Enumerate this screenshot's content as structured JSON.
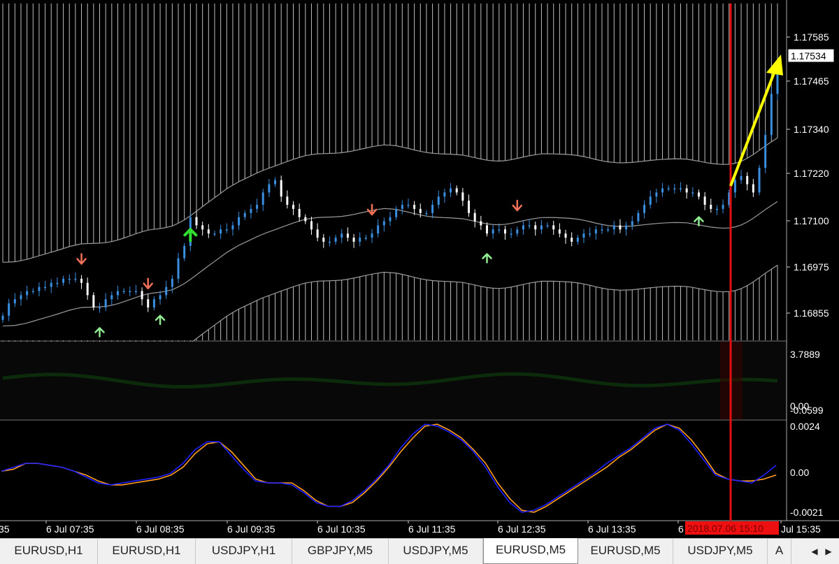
{
  "main_chart": {
    "price_axis_labels": [
      "1.17585",
      "1.17465",
      "1.17340",
      "1.17220",
      "1.17100",
      "1.16975",
      "1.16855"
    ],
    "current_price": "1.17534",
    "background_color": "#000000",
    "bull_candle_color": "#3a8fe0",
    "bear_candle_color": "#ffffff",
    "band_color": "#9a9a9a",
    "signal_up_color": "#90ee90",
    "signal_down_color": "#f07058",
    "annotation_arrow_color": "#ffff00"
  },
  "indicator_1": {
    "axis_labels": [
      "3.7889",
      "0.00",
      "-0.0599"
    ]
  },
  "indicator_2": {
    "axis_labels": [
      "0.0024",
      "0.00",
      "-0.0021"
    ],
    "fast_line_color": "#ffa020",
    "slow_line_color": "#2020ff"
  },
  "time_axis": {
    "labels": [
      "35",
      "6 Jul 07:35",
      "6 Jul 08:35",
      "6 Jul 09:35",
      "6 Jul 10:35",
      "6 Jul 11:35",
      "6 Jul 12:35",
      "6 Jul 13:35",
      "6",
      "Jul 15:35"
    ],
    "cursor_label": "2018.07.06 15:10",
    "cursor_color": "#e01010"
  },
  "tabs": [
    {
      "label": "EURUSD,H1",
      "active": false
    },
    {
      "label": "EURUSD,H1",
      "active": false
    },
    {
      "label": "USDJPY,H1",
      "active": false
    },
    {
      "label": "GBPJPY,M5",
      "active": false
    },
    {
      "label": "USDJPY,M5",
      "active": false
    },
    {
      "label": "EURUSD,M5",
      "active": true
    },
    {
      "label": "EURUSD,M5",
      "active": false
    },
    {
      "label": "USDJPY,M5",
      "active": false
    },
    {
      "label": "A",
      "active": false
    }
  ],
  "tab_scroll": {
    "left": "◀",
    "right": "▶"
  },
  "chart_data": [
    {
      "type": "line",
      "ylim": [
        1.168,
        1.1762
      ],
      "x_tick_labels": [
        "6 Jul 07:35",
        "6 Jul 08:35",
        "6 Jul 09:35",
        "6 Jul 10:35",
        "6 Jul 11:35",
        "6 Jul 12:35",
        "6 Jul 13:35",
        "Jul 15:35"
      ],
      "y_tick_labels": [
        "1.17585",
        "1.17465",
        "1.17340",
        "1.17220",
        "1.17100",
        "1.16975",
        "1.16855"
      ],
      "close": [
        1.1686,
        1.1689,
        1.169,
        1.1691,
        1.1692,
        1.1692,
        1.1693,
        1.1693,
        1.1694,
        1.1694,
        1.1695,
        1.1695,
        1.1695,
        1.1694,
        1.1691,
        1.1688,
        1.1688,
        1.169,
        1.1691,
        1.1692,
        1.1692,
        1.1692,
        1.1692,
        1.169,
        1.1688,
        1.169,
        1.1691,
        1.1693,
        1.1695,
        1.17,
        1.1703,
        1.171,
        1.1708,
        1.1707,
        1.1706,
        1.1706,
        1.1707,
        1.1707,
        1.1708,
        1.171,
        1.1711,
        1.1712,
        1.1713,
        1.1716,
        1.1718,
        1.1719,
        1.1715,
        1.1713,
        1.1712,
        1.171,
        1.1709,
        1.1707,
        1.1705,
        1.1704,
        1.1704,
        1.1705,
        1.1706,
        1.1705,
        1.1704,
        1.1705,
        1.1705,
        1.1706,
        1.1708,
        1.1709,
        1.171,
        1.1712,
        1.1713,
        1.1713,
        1.1712,
        1.1711,
        1.1711,
        1.1713,
        1.1715,
        1.1716,
        1.1717,
        1.1716,
        1.1714,
        1.1711,
        1.1709,
        1.1708,
        1.1706,
        1.1707,
        1.1707,
        1.1706,
        1.1706,
        1.1707,
        1.1708,
        1.1708,
        1.1707,
        1.1708,
        1.1708,
        1.1707,
        1.1706,
        1.1705,
        1.1704,
        1.1705,
        1.1706,
        1.1706,
        1.1707,
        1.1707,
        1.1707,
        1.1708,
        1.1707,
        1.1708,
        1.1709,
        1.1711,
        1.1713,
        1.1715,
        1.1716,
        1.1717,
        1.1717,
        1.1717,
        1.1717,
        1.1716,
        1.1716,
        1.1715,
        1.1713,
        1.1712,
        1.1712,
        1.1713,
        1.1716,
        1.1719,
        1.172,
        1.1718,
        1.1716,
        1.1722,
        1.173,
        1.174,
        1.1746
      ],
      "upper_band": [
        1.1699,
        1.16991,
        1.16996,
        1.17004,
        1.17012,
        1.1702,
        1.17029,
        1.17035,
        1.17036,
        1.17037,
        1.17042,
        1.17051,
        1.17061,
        1.17069,
        1.17072,
        1.17077,
        1.1709,
        1.17109,
        1.1713,
        1.1715,
        1.1717,
        1.17186,
        1.17199,
        1.17212,
        1.17222,
        1.17232,
        1.17242,
        1.1725,
        1.17254,
        1.17255,
        1.17256,
        1.1726,
        1.17266,
        1.17272,
        1.17276,
        1.17274,
        1.17268,
        1.17261,
        1.17256,
        1.17254,
        1.17253,
        1.17251,
        1.17245,
        1.17239,
        1.17236,
        1.17238,
        1.17244,
        1.1725,
        1.17254,
        1.17254,
        1.17253,
        1.17251,
        1.17246,
        1.17239,
        1.17234,
        1.17232,
        1.17233,
        1.17236,
        1.17239,
        1.17241,
        1.17242,
        1.17241,
        1.17236,
        1.17231,
        1.17228,
        1.17229,
        1.17238,
        1.17255,
        1.17275,
        1.17293
      ],
      "mid_band_note": "midline and lower band drawn symmetrically around the upper band",
      "signals": [
        {
          "bar": 13,
          "type": "down"
        },
        {
          "bar": 16,
          "type": "up"
        },
        {
          "bar": 24,
          "type": "down"
        },
        {
          "bar": 26,
          "type": "up"
        },
        {
          "bar": 31,
          "type": "up-strong"
        },
        {
          "bar": 61,
          "type": "down"
        },
        {
          "bar": 80,
          "type": "up"
        },
        {
          "bar": 85,
          "type": "down"
        },
        {
          "bar": 115,
          "type": "up"
        }
      ]
    },
    {
      "type": "line",
      "ylim": [
        -0.0021,
        0.0024
      ],
      "y_tick_labels": [
        "0.0024",
        "0.00",
        "-0.0021"
      ],
      "series": [
        {
          "values": [
            0.0,
            0.0002,
            0.0004,
            0.0004,
            0.0003,
            0.0002,
            0.0,
            -0.0003,
            -0.0006,
            -0.0007,
            -0.0006,
            -0.0005,
            -0.0004,
            -0.0003,
            -0.0001,
            0.0004,
            0.0011,
            0.0015,
            0.0015,
            0.0008,
            0.0001,
            -0.0005,
            -0.0006,
            -0.0006,
            -0.0007,
            -0.0011,
            -0.0016,
            -0.0018,
            -0.0018,
            -0.0015,
            -0.001,
            -0.0004,
            0.0003,
            0.0012,
            0.0019,
            0.0024,
            0.0023,
            0.002,
            0.0016,
            0.001,
            0.0002,
            -0.0008,
            -0.0016,
            -0.0021,
            -0.002,
            -0.0017,
            -0.0013,
            -0.0009,
            -0.0005,
            -0.0001,
            0.0004,
            0.0008,
            0.0012,
            0.0017,
            0.0022,
            0.0024,
            0.0021,
            0.0014,
            0.0006,
            -0.0002,
            -0.0004,
            -0.0005,
            -0.0006,
            -0.0002,
            0.0003
          ]
        },
        {
          "values": [
            0.0,
            0.0001,
            0.0004,
            0.0004,
            0.0003,
            0.0002,
            0.0,
            -0.0002,
            -0.0005,
            -0.0007,
            -0.0007,
            -0.0006,
            -0.0005,
            -0.0004,
            -0.0002,
            0.0002,
            0.0009,
            0.0014,
            0.0015,
            0.001,
            0.0003,
            -0.0004,
            -0.0006,
            -0.0006,
            -0.0006,
            -0.001,
            -0.0015,
            -0.0018,
            -0.0018,
            -0.0016,
            -0.0011,
            -0.0005,
            0.0002,
            0.001,
            0.0017,
            0.0023,
            0.0024,
            0.0021,
            0.0017,
            0.0011,
            0.0004,
            -0.0006,
            -0.0014,
            -0.002,
            -0.0021,
            -0.0018,
            -0.0014,
            -0.001,
            -0.0006,
            -0.0002,
            0.0002,
            0.0007,
            0.0011,
            0.0016,
            0.0021,
            0.0024,
            0.0022,
            0.0016,
            0.0008,
            -0.0001,
            -0.0004,
            -0.0005,
            -0.0005,
            -0.0004,
            -0.0002
          ]
        }
      ]
    }
  ]
}
